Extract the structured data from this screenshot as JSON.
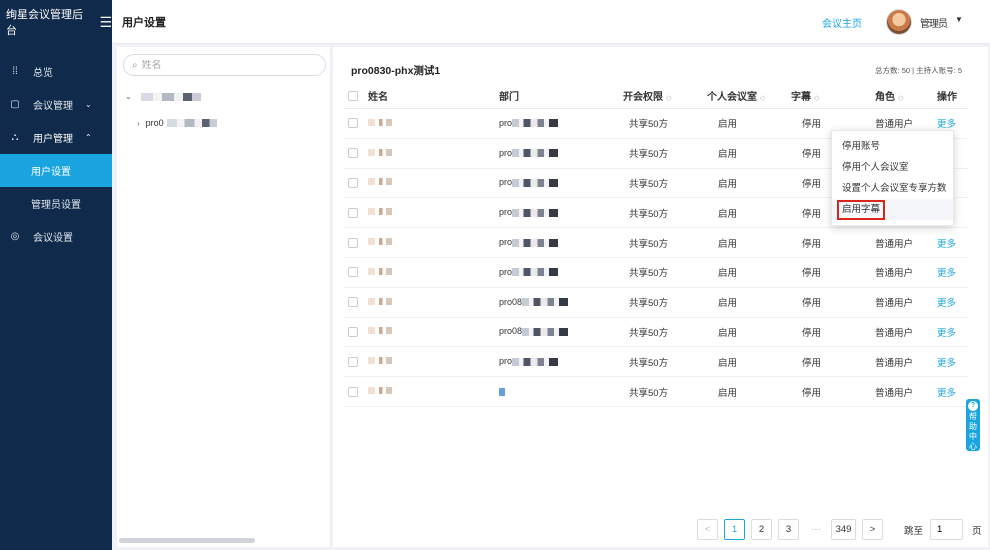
{
  "sidebar": {
    "brand": "绚星会议管理后台",
    "items": [
      {
        "label": "总览"
      },
      {
        "label": "会议管理"
      },
      {
        "label": "用户管理"
      },
      {
        "label": "用户设置"
      },
      {
        "label": "管理员设置"
      },
      {
        "label": "会议设置"
      }
    ]
  },
  "header": {
    "title": "用户设置",
    "home_link": "会议主页",
    "user_name": "管理员"
  },
  "tree": {
    "search_placeholder": "姓名",
    "child_label": "pro0"
  },
  "main": {
    "group_title": "pro0830-phx测试1",
    "stats": "总方数: 50 | 主持人账号: 5",
    "columns": [
      "姓名",
      "部门",
      "开会权限",
      "个人会议室",
      "字幕",
      "角色",
      "操作"
    ],
    "rows": [
      {
        "name": "",
        "dept": "pro",
        "perm": "共享50方",
        "room": "启用",
        "sub": "停用",
        "role": "",
        "op": ""
      },
      {
        "name": "",
        "dept": "pro",
        "perm": "共享50方",
        "room": "启用",
        "sub": "停用",
        "role": "",
        "op": ""
      },
      {
        "name": "",
        "dept": "pro",
        "perm": "共享50方",
        "room": "启用",
        "sub": "停用",
        "role": "",
        "op": ""
      },
      {
        "name": "",
        "dept": "pro",
        "perm": "共享50方",
        "room": "启用",
        "sub": "停用",
        "role": "",
        "op": ""
      },
      {
        "name": "",
        "dept": "pro",
        "perm": "共享50方",
        "room": "启用",
        "sub": "停用",
        "role": "普通用户",
        "op": "更多"
      },
      {
        "name": "",
        "dept": "pro",
        "perm": "共享50方",
        "room": "启用",
        "sub": "停用",
        "role": "普通用户",
        "op": "更多"
      },
      {
        "name": "",
        "dept": "pro08",
        "perm": "共享50方",
        "room": "启用",
        "sub": "停用",
        "role": "普通用户",
        "op": "更多"
      },
      {
        "name": "",
        "dept": "pro08",
        "perm": "共享50方",
        "room": "启用",
        "sub": "停用",
        "role": "普通用户",
        "op": "更多"
      },
      {
        "name": "",
        "dept": "pro",
        "perm": "共享50方",
        "room": "启用",
        "sub": "停用",
        "role": "普通用户",
        "op": "更多"
      },
      {
        "name": "",
        "dept": "",
        "perm": "共享50方",
        "room": "启用",
        "sub": "停用",
        "role": "普通用户",
        "op": "更多"
      }
    ],
    "first_row": {
      "role": "普通用户",
      "op": "更多"
    }
  },
  "dropdown": {
    "items": [
      "停用账号",
      "停用个人会议室",
      "设置个人会议室专享方数",
      "启用字幕"
    ]
  },
  "help": {
    "chars": [
      "帮",
      "助",
      "中",
      "心"
    ]
  },
  "pager": {
    "prev": "<",
    "pages": [
      "1",
      "2",
      "3"
    ],
    "dots": "···",
    "last": "349",
    "next": ">",
    "jump_label": "跳至",
    "jump_value": "1",
    "page_label": "页"
  },
  "colors": {
    "sidebar_bg": "#0f2a4a",
    "accent": "#1ba5e0",
    "highlight_box": "#d9261c"
  },
  "icons": [
    "menu-icon",
    "dashboard-icon",
    "calendar-icon",
    "org-icon",
    "settings-icon",
    "search-icon",
    "chevron-down-icon",
    "chevron-up-icon",
    "chevron-right-icon",
    "sort-icon",
    "help-icon"
  ]
}
